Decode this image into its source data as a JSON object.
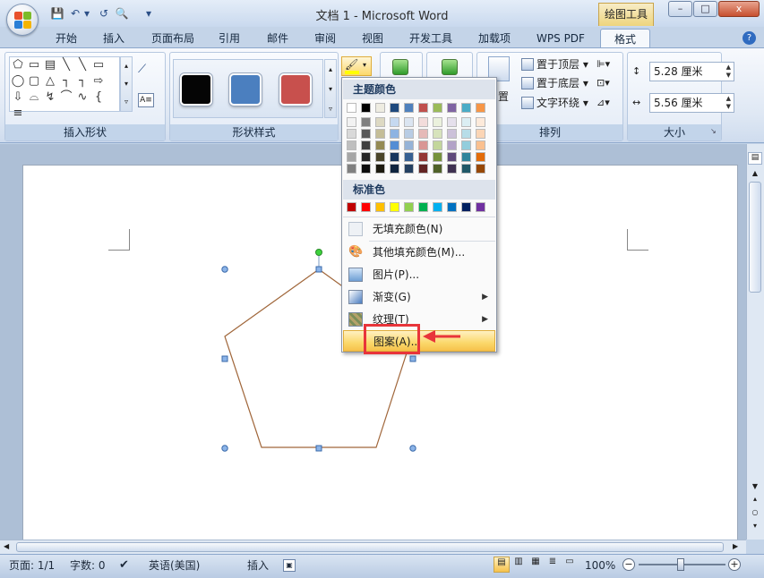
{
  "window": {
    "title": "文档 1 - Microsoft Word",
    "contextual_tab": "绘图工具",
    "controls": {
      "minimize": "–",
      "maximize": "□",
      "close": "x"
    }
  },
  "qat": {
    "save": "💾",
    "undo": "↶",
    "dropdown": "▾",
    "redo": "↺",
    "preview": "🔍",
    "customize": "▾"
  },
  "tabs": [
    "开始",
    "插入",
    "页面布局",
    "引用",
    "邮件",
    "审阅",
    "视图",
    "开发工具",
    "加载项",
    "WPS PDF",
    "格式"
  ],
  "help": "?",
  "ribbon": {
    "insert_shapes": {
      "label": "插入形状",
      "shapes": [
        "⬠",
        "▭",
        "▤",
        "╲",
        "╲",
        "▭",
        "◯",
        "▢",
        "△",
        "┐",
        "┐",
        "⇨",
        "⇩",
        "⌓",
        "↯",
        "⌒",
        "∿",
        "{",
        "≡"
      ]
    },
    "shape_styles": {
      "label": "形状样式",
      "swatches": [
        "#050505",
        "#4b7fbf",
        "#c8504d"
      ]
    },
    "arrange": {
      "label": "排列",
      "bring_front": "置于顶层",
      "send_back": "置于底层",
      "text_wrap": "文字环绕",
      "position": "置"
    },
    "size": {
      "label": "大小",
      "height": "5.28 厘米",
      "width": "5.56 厘米"
    }
  },
  "fill_menu": {
    "theme_colors_heading": "主题颜色",
    "theme_top": [
      "#ffffff",
      "#000000",
      "#eeece1",
      "#1f497d",
      "#4f81bd",
      "#c0504d",
      "#9bbb59",
      "#8064a2",
      "#4bacc6",
      "#f79646"
    ],
    "theme_cols": [
      [
        "#f2f2f2",
        "#d9d9d9",
        "#bfbfbf",
        "#a6a6a6",
        "#808080"
      ],
      [
        "#808080",
        "#595959",
        "#404040",
        "#262626",
        "#0d0d0d"
      ],
      [
        "#ddd9c3",
        "#c4bd97",
        "#948a54",
        "#4a452a",
        "#1d1b10"
      ],
      [
        "#c6d9f0",
        "#8db3e2",
        "#548dd4",
        "#17365d",
        "#0f243e"
      ],
      [
        "#dbe5f1",
        "#b8cce4",
        "#95b3d7",
        "#366092",
        "#244061"
      ],
      [
        "#f2dcdb",
        "#e5b9b7",
        "#d99694",
        "#953734",
        "#632423"
      ],
      [
        "#ebf1dd",
        "#d7e3bc",
        "#c3d69b",
        "#76923c",
        "#4f6128"
      ],
      [
        "#e5e0ec",
        "#ccc1d9",
        "#b2a2c7",
        "#5f497a",
        "#3f3151"
      ],
      [
        "#dbeef3",
        "#b7dde8",
        "#92cddc",
        "#31859b",
        "#205867"
      ],
      [
        "#fdeada",
        "#fbd5b5",
        "#fac08f",
        "#e36c09",
        "#974806"
      ]
    ],
    "standard_colors_heading": "标准色",
    "standard": [
      "#c00000",
      "#ff0000",
      "#ffc000",
      "#ffff00",
      "#92d050",
      "#00b050",
      "#00b0f0",
      "#0070c0",
      "#002060",
      "#7030a0"
    ],
    "items": {
      "no_fill": "无填充颜色(N)",
      "more_colors": "其他填充颜色(M)...",
      "picture": "图片(P)...",
      "gradient": "渐变(G)",
      "texture": "纹理(T)",
      "pattern": "图案(A)..."
    }
  },
  "status": {
    "page": "页面: 1/1",
    "words": "字数: 0",
    "language": "英语(美国)",
    "mode": "插入",
    "zoom": "100%"
  },
  "colors": {
    "accent_red": "#e8343a",
    "highlight": "#fbd86b",
    "shape_outline": "#a0663a"
  }
}
